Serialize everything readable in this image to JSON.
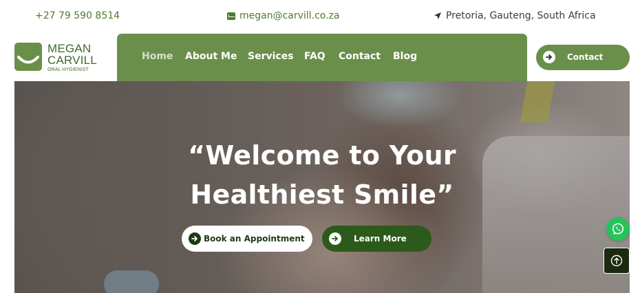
{
  "topbar": {
    "phone": "+27 79 590 8514",
    "email": "megan@carvill.co.za",
    "location": "Pretoria, Gauteng, South Africa",
    "email_icon": "envelope-icon",
    "location_icon": "location-arrow-icon"
  },
  "logo": {
    "line1": "MEGAN",
    "line2": "CARVILL",
    "subtitle": "ORAL HYGIENIST",
    "icon": "smile-icon"
  },
  "nav": {
    "items": [
      {
        "label": "Home",
        "active": true
      },
      {
        "label": "About Me"
      },
      {
        "label": "Services"
      },
      {
        "label": "FAQ"
      },
      {
        "label": "Contact"
      },
      {
        "label": "Blog"
      }
    ],
    "contact_button": "Contact"
  },
  "hero": {
    "title_line1": "“Welcome to Your",
    "title_line2": "Healthiest Smile”",
    "primary_button": "Book an Appointment",
    "secondary_button": "Learn More"
  },
  "floating": {
    "whatsapp_icon": "whatsapp-icon",
    "back_to_top_icon": "arrow-up-circle-icon"
  },
  "colors": {
    "brand_green": "#6a8f4b",
    "dark_green": "#2c5a1a",
    "whatsapp_green": "#25c35a"
  }
}
